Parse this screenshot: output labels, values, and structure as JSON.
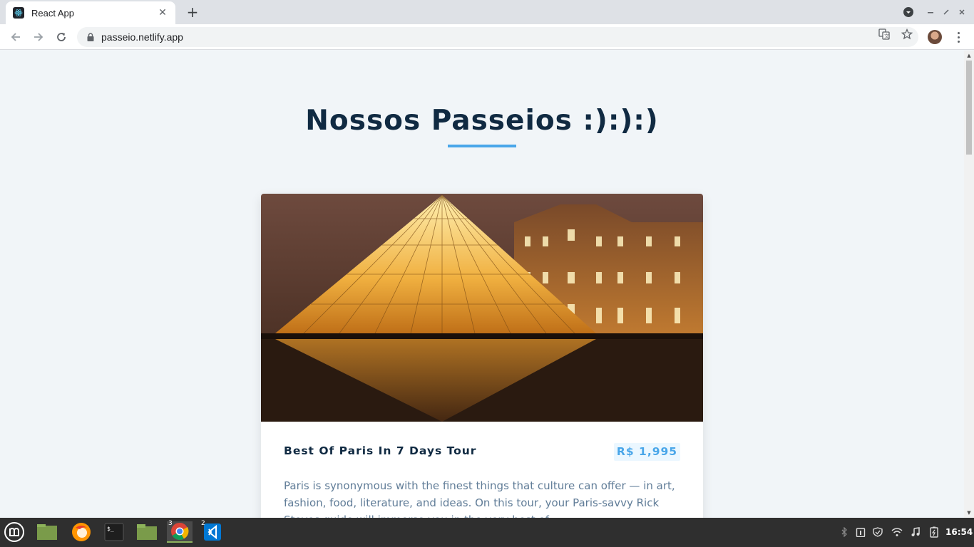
{
  "browser": {
    "tab_title": "React App",
    "url": "passeio.netlify.app"
  },
  "page": {
    "title": "Nossos Passeios :):):)",
    "tour": {
      "name": "Best Of Paris In 7 Days Tour",
      "price": "R$ 1,995",
      "info": "Paris is synonymous with the finest things that culture can offer — in art, fashion, food, literature, and ideas. On this tour, your Paris-savvy Rick Steves guide will immerse you in the very best of ...",
      "image": "louvre-pyramid-night"
    }
  },
  "taskbar": {
    "items": [
      {
        "name": "mint-menu-icon"
      },
      {
        "name": "show-desktop-icon"
      },
      {
        "name": "firefox-icon"
      },
      {
        "name": "terminal-icon"
      },
      {
        "name": "files-icon"
      },
      {
        "name": "chrome-icon",
        "badge": "3"
      },
      {
        "name": "vscode-icon",
        "badge": "2"
      }
    ],
    "clock": "16:54"
  },
  "colors": {
    "heading": "#102a42",
    "accent": "#49a6e9",
    "price_bg": "#ebf7ff",
    "body_text": "#617d98",
    "page_bg": "#f1f5f8"
  }
}
